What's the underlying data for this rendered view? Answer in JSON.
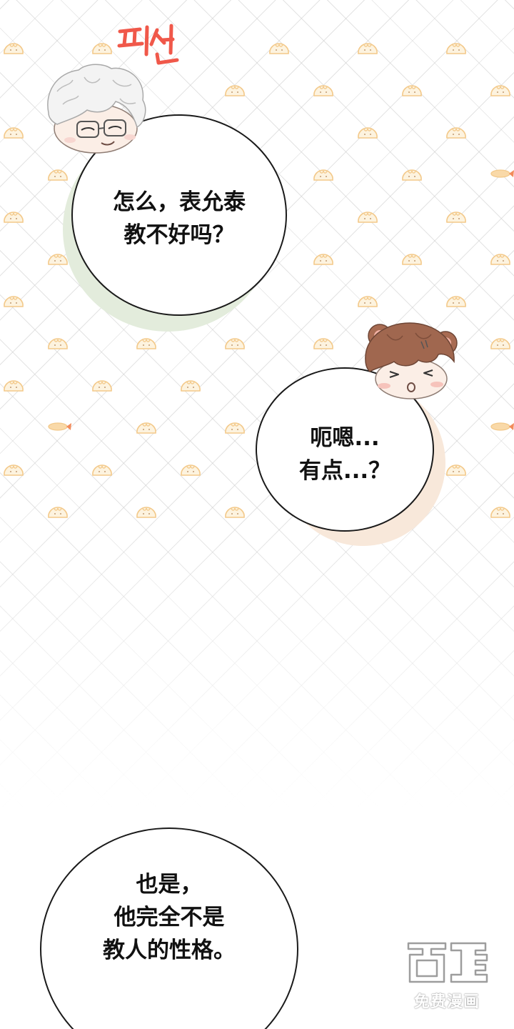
{
  "sound_effect": {
    "text": "피식",
    "color": "#f0584a"
  },
  "bubbles": [
    {
      "speaker": "silver-haired man with glasses",
      "text": "怎么，表允泰\n教不好吗？",
      "shadow_color": "#e3ecdc"
    },
    {
      "speaker": "brown-haired boy with bear ears",
      "text": "呃嗯...\n有点...？",
      "shadow_color": "#f8e8da"
    },
    {
      "speaker": "off-panel",
      "text": "也是，\n他完全不是\n教人的性格。",
      "shadow_color": ""
    }
  ],
  "background": {
    "pattern": "diagonal lattice with steamed bun doodles",
    "bun_color": "#f3c98a",
    "lattice_color": "#cdcdcd"
  },
  "watermark": {
    "logo_text": "画涯",
    "caption": "免费漫画"
  }
}
